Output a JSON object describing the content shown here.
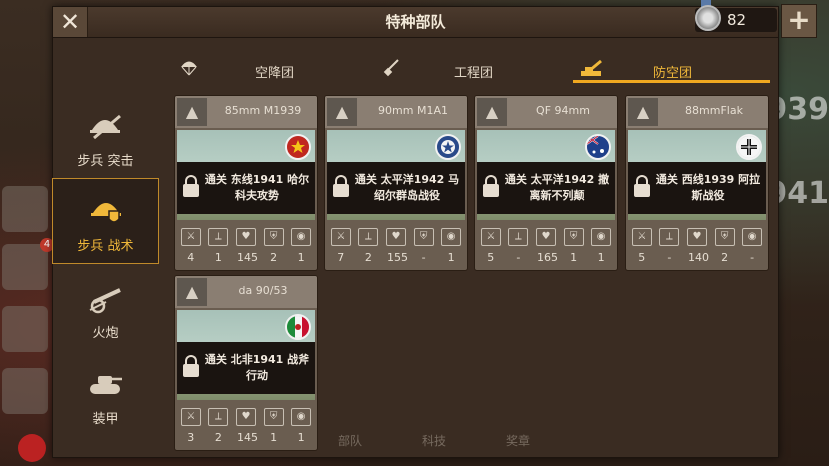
{
  "window": {
    "title": "特种部队",
    "close_label": "✕",
    "plus_label": "+"
  },
  "currency": {
    "value": "82",
    "icon": "silver-medal-icon"
  },
  "tabs": [
    {
      "label": "空降团",
      "icon": "parachute-icon",
      "active": false
    },
    {
      "label": "工程团",
      "icon": "shovel-icon",
      "active": false
    },
    {
      "label": "防空团",
      "icon": "aa-gun-icon",
      "active": true
    }
  ],
  "sidebar": {
    "items": [
      {
        "label": "步兵 突击",
        "icon": "assault-helmet-icon",
        "active": false
      },
      {
        "label": "步兵 战术",
        "icon": "tactical-helmet-icon",
        "active": true
      },
      {
        "label": "火炮",
        "icon": "artillery-icon",
        "active": false
      },
      {
        "label": "装甲",
        "icon": "tank-icon",
        "active": false
      }
    ]
  },
  "cards": [
    {
      "name": "85mm M1939",
      "badge": "aa-unit-icon",
      "flag": "ussr",
      "lock_text": "通关 东线1941 哈尔科夫攻势",
      "stats": [
        "4",
        "1",
        "145",
        "2",
        "1"
      ]
    },
    {
      "name": "90mm M1A1",
      "badge": "aa-unit-icon",
      "flag": "usa",
      "lock_text": "通关 太平洋1942 马绍尔群岛战役",
      "stats": [
        "7",
        "2",
        "155",
        "-",
        "1"
      ]
    },
    {
      "name": "QF 94mm",
      "badge": "aa-unit-icon",
      "flag": "australia",
      "lock_text": "通关 太平洋1942 撤离新不列颠",
      "stats": [
        "5",
        "-",
        "165",
        "1",
        "1"
      ]
    },
    {
      "name": "88mmFlak",
      "badge": "aa-unit-icon",
      "flag": "germany",
      "lock_text": "通关 西线1939 阿拉斯战役",
      "stats": [
        "5",
        "-",
        "140",
        "2",
        "-"
      ]
    },
    {
      "name": "da 90/53",
      "badge": "aa-unit-icon",
      "flag": "italy",
      "lock_text": "通关 北非1941 战斧行动",
      "stats": [
        "3",
        "2",
        "145",
        "1",
        "1"
      ]
    }
  ],
  "stat_icons": [
    "attack-icon",
    "boot-icon",
    "heart-icon",
    "shield-icon",
    "eye-icon"
  ],
  "background": {
    "badge_count": "4",
    "bottom_nav": [
      "部队",
      "科技",
      "奖章"
    ],
    "right_numbers": [
      "939",
      "941"
    ]
  },
  "colors": {
    "accent": "#f0a820",
    "panel": "#3a2c22"
  }
}
